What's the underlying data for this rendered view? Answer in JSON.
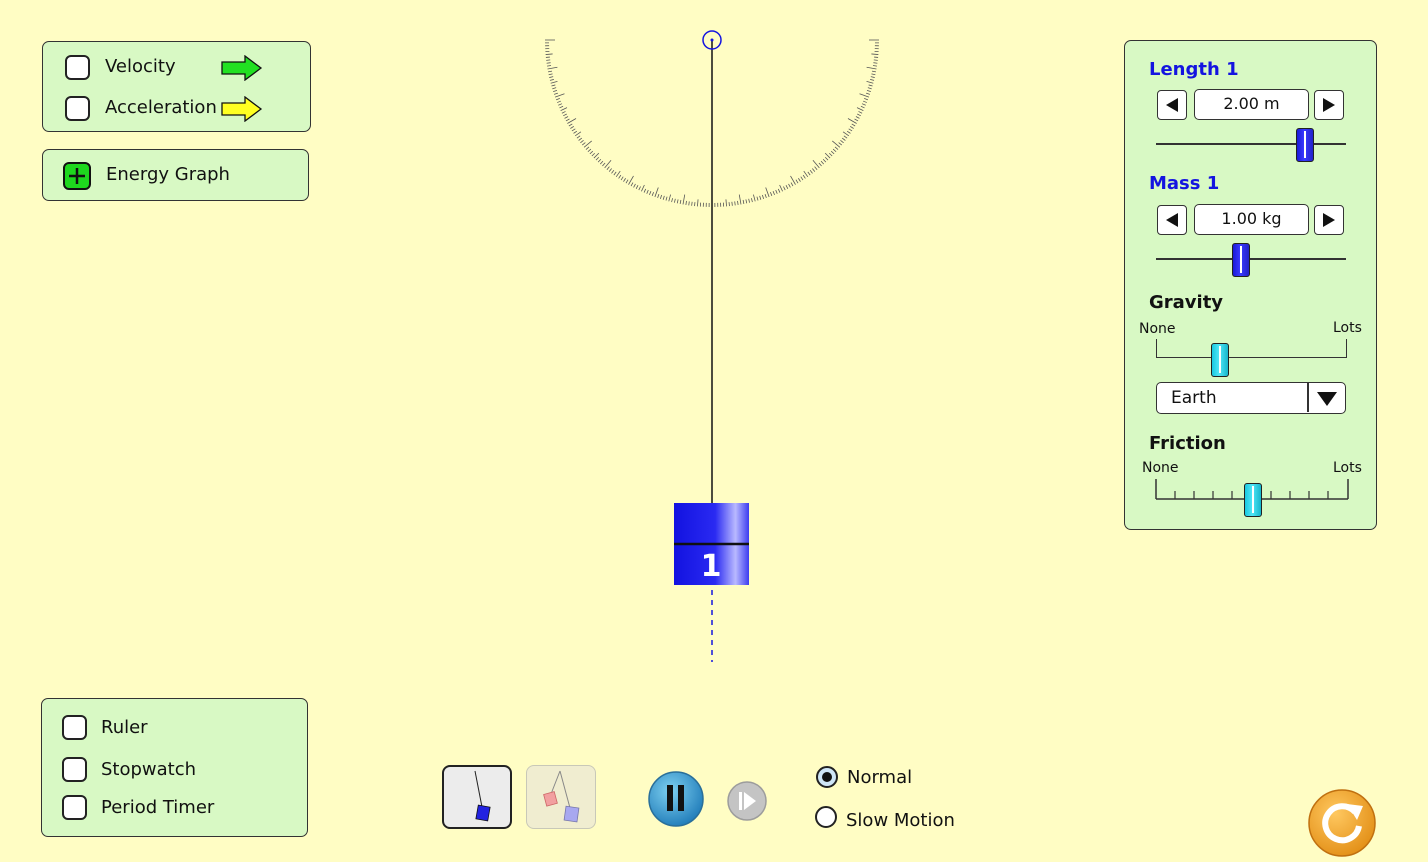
{
  "vectors_panel": {
    "velocity_label": "Velocity",
    "acceleration_label": "Acceleration",
    "velocity_checked": false,
    "acceleration_checked": false,
    "velocity_arrow_color": "#22E022",
    "acceleration_arrow_color": "#FFFF22"
  },
  "energy_panel": {
    "label": "Energy Graph",
    "expand_icon": "plus-icon"
  },
  "tools_panel": {
    "ruler_label": "Ruler",
    "stopwatch_label": "Stopwatch",
    "period_timer_label": "Period Timer"
  },
  "pendulum": {
    "mass_label": "1",
    "mass_color": "#1E1EE8"
  },
  "controls": {
    "length": {
      "title": "Length 1",
      "value": "2.00 m",
      "slider_fraction": 0.78
    },
    "mass": {
      "title": "Mass 1",
      "value": "1.00 kg",
      "slider_fraction": 0.44
    },
    "gravity": {
      "title": "Gravity",
      "min_label": "None",
      "max_label": "Lots",
      "slider_fraction": 0.33,
      "selected": "Earth"
    },
    "friction": {
      "title": "Friction",
      "min_label": "None",
      "max_label": "Lots",
      "slider_fraction": 0.51
    }
  },
  "bottom_bar": {
    "speed_options": [
      "Normal",
      "Slow Motion"
    ],
    "selected_speed": "Normal",
    "play_state": "playing",
    "pause_icon": "pause-icon",
    "step_icon": "step-forward-icon",
    "reset_icon": "reset-icon"
  },
  "colors": {
    "background": "#FFFDC4",
    "panel": "#D8F9C4",
    "title_blue": "#1414E0",
    "reset_orange": "#F0A020"
  }
}
